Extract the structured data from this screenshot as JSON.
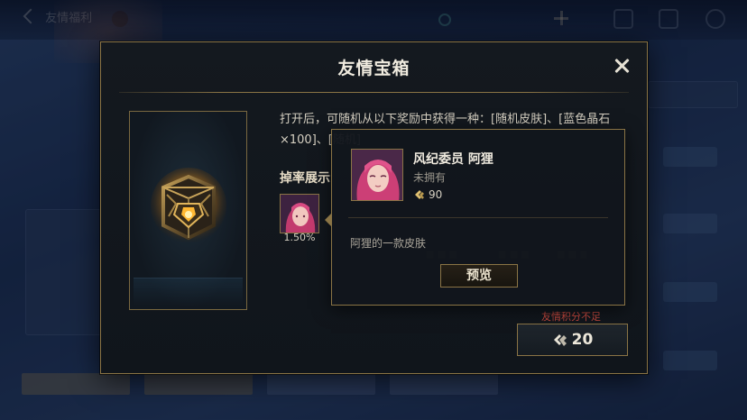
{
  "background": {
    "back_label": "友情福利"
  },
  "modal": {
    "title": "友情宝箱",
    "description": "打开后，可随机从以下奖励中获得一种：[随机皮肤]、[蓝色晶石×100]、[随机]",
    "drop_section_title": "掉率展示",
    "drop_items": [
      {
        "rate": "1.50%",
        "icon": "ahri-portrait"
      }
    ],
    "insufficient_text": "友情积分不足",
    "cost_value": "20",
    "cost_icon": "friendship-points-icon"
  },
  "tooltip": {
    "skin_name": "风纪委员 阿狸",
    "status": "未拥有",
    "price": "90",
    "price_icon": "blue-essence-icon",
    "description": "阿狸的一款皮肤",
    "preview_label": "预览"
  },
  "colors": {
    "gold_border": "#8a7445",
    "panel_bg": "#14191f",
    "warning_red": "#c0473d"
  }
}
